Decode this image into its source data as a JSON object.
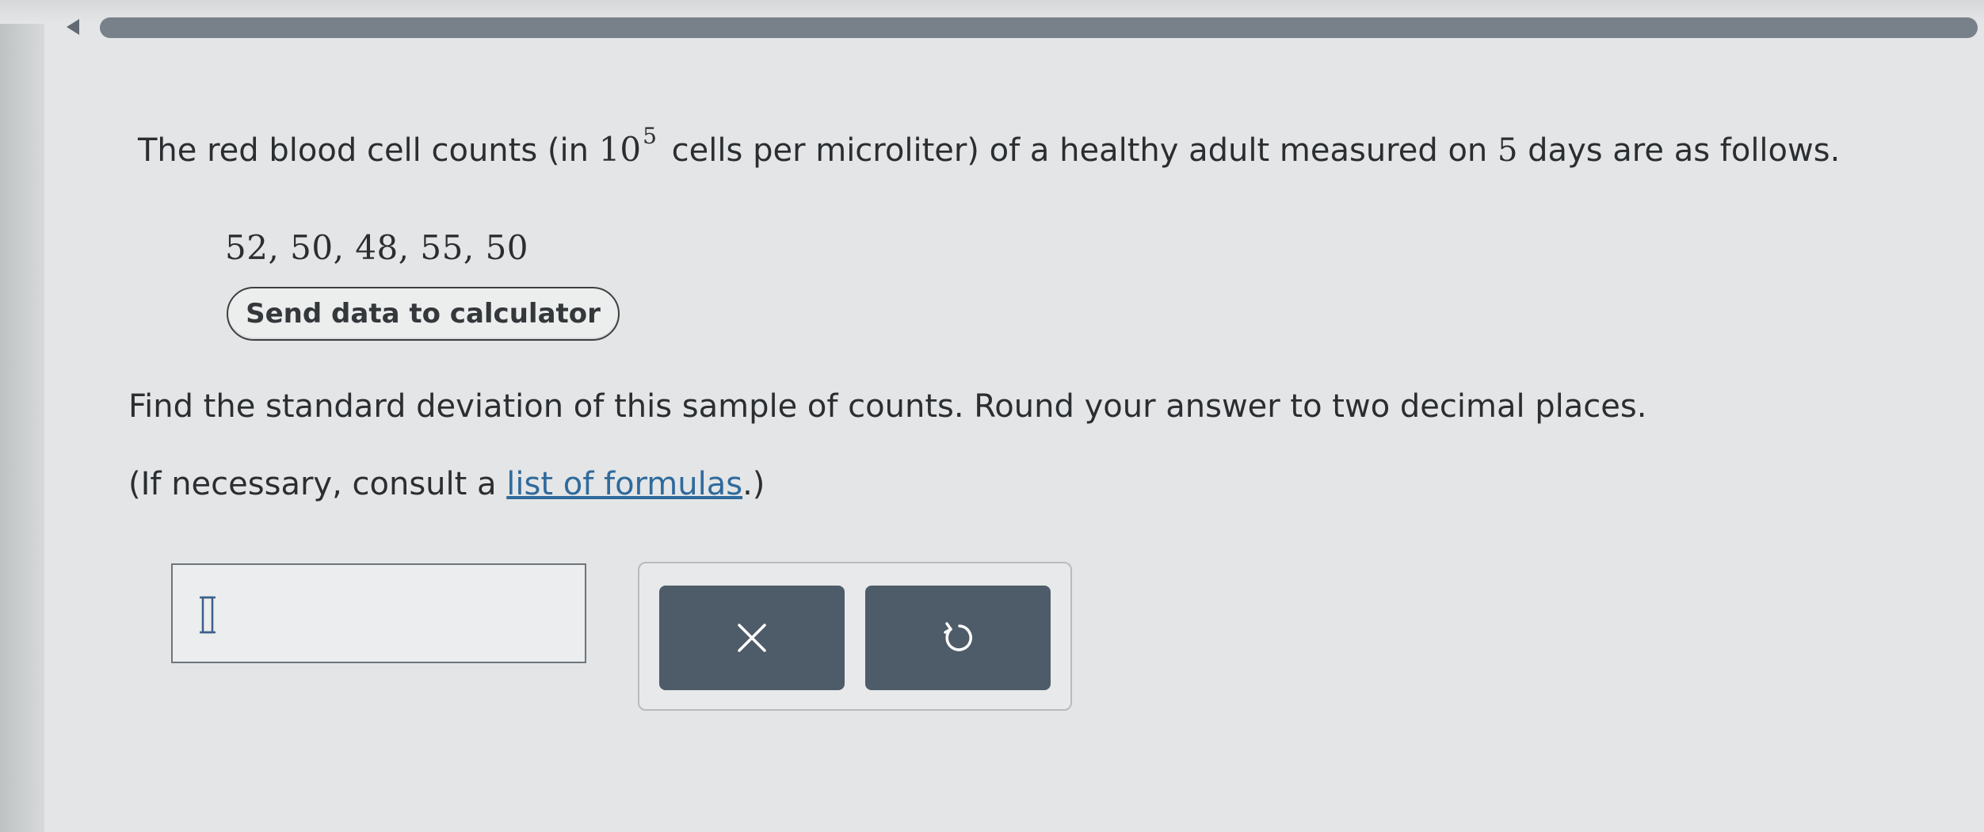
{
  "question": {
    "intro": "The red blood cell counts (in ",
    "base": "10",
    "exponent": "5",
    "middle": " cells per microliter) of a healthy adult measured on ",
    "days": "5",
    "end": " days are as follows."
  },
  "data_values": "52, 50, 48, 55, 50",
  "send_button_label": "Send data to calculator",
  "instruction": "Find the standard deviation of this sample of counts. Round your answer to two decimal places.",
  "formula_note": {
    "prefix": "(If necessary, consult a ",
    "link": "list of formulas",
    "suffix": ".)"
  },
  "answer": {
    "value": ""
  },
  "icons": {
    "back": "back-arrow-icon",
    "clear": "close-icon",
    "reset": "undo-icon",
    "cursor": "text-cursor-icon"
  },
  "colors": {
    "button_bg": "#4d5c68",
    "link": "#2f6a9c",
    "progress": "#78808a"
  }
}
